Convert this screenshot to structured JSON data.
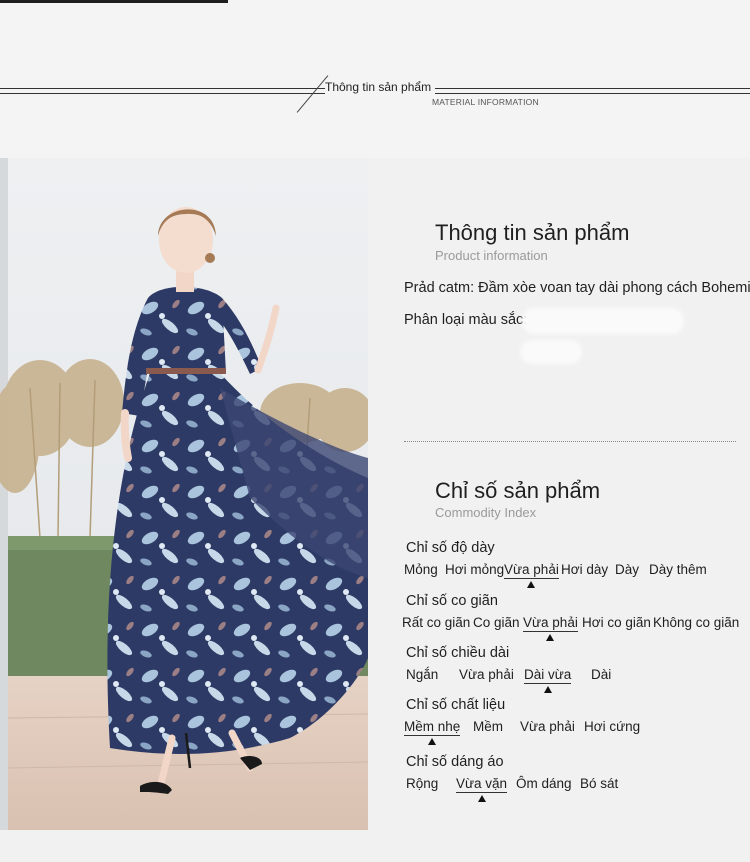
{
  "header": {
    "title": "Thông tin sản phẩm",
    "subtitle": "MATERIAL INFORMATION"
  },
  "product_info": {
    "title": "Thông tin sản phẩm",
    "subtitle": "Product  information",
    "name_line": "Prảd catm: Đầm xòe voan tay dài phong cách Bohemian",
    "color_label": "Phân loại màu sắc:"
  },
  "product_index": {
    "title": "Chỉ số sản phẩm",
    "subtitle": "Commodity Index",
    "groups": [
      {
        "label": "Chỉ số độ dày",
        "options": [
          "Mỏng",
          "Hơi mỏng",
          "Vừa phải",
          "Hơi dày",
          "Dày",
          "Dày thêm"
        ],
        "selected": "Vừa phải"
      },
      {
        "label": "Chỉ số co giãn",
        "options": [
          "Rất co giãn",
          "Co giãn",
          "Vừa phải",
          "Hơi co giãn",
          "Không co giãn"
        ],
        "selected": "Vừa phải"
      },
      {
        "label": "Chỉ số chiều dài",
        "options": [
          "Ngắn",
          "Vừa phải",
          "Dài vừa",
          "Dài"
        ],
        "selected": "Dài vừa"
      },
      {
        "label": "Chỉ số chất liệu",
        "options": [
          "Mềm nhẹ",
          "Mềm",
          "Vừa phải",
          "Hơi cứng"
        ],
        "selected": "Mềm nhẹ"
      },
      {
        "label": "Chỉ số dáng áo",
        "options": [
          "Rộng",
          "Vừa vặn",
          "Ôm dáng",
          "Bó sát"
        ],
        "selected": "Vừa vặn"
      }
    ]
  },
  "colors": {
    "dress": "#2e3a66",
    "flower": "#a9c4dc",
    "wall": "#e9ecef",
    "grass": "#c9b594"
  }
}
